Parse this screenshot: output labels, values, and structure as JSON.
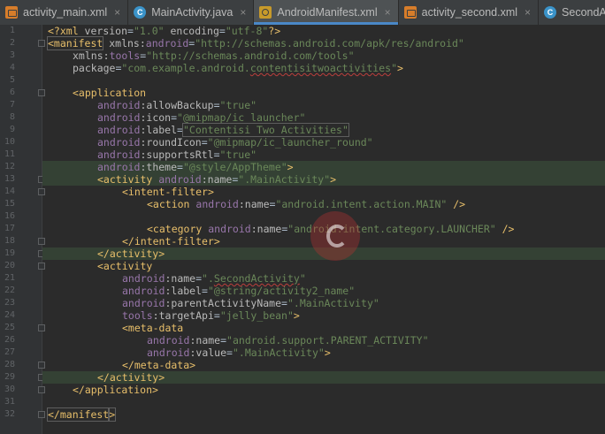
{
  "tabs": [
    {
      "label": "activity_main.xml",
      "icon": "xml-file-icon"
    },
    {
      "label": "MainActivity.java",
      "icon": "java-class-icon"
    },
    {
      "label": "AndroidManifest.xml",
      "icon": "manifest-file-icon",
      "active": true
    },
    {
      "label": "activity_second.xml",
      "icon": "xml-file-icon"
    },
    {
      "label": "SecondActi",
      "icon": "java-class-icon"
    }
  ],
  "close_glyph": "×",
  "line_numbers": [
    "1",
    "2",
    "3",
    "4",
    "5",
    "6",
    "7",
    "8",
    "9",
    "10",
    "11",
    "12",
    "13",
    "14",
    "15",
    "16",
    "17",
    "18",
    "19",
    "20",
    "21",
    "22",
    "23",
    "24",
    "25",
    "26",
    "27",
    "28",
    "29",
    "30",
    "31",
    "32"
  ],
  "code": {
    "l1": {
      "pi_open": "<?xml",
      "v_attr": " version",
      "v_eq": "=",
      "v_val": "\"1.0\"",
      "e_attr": " encoding",
      "e_eq": "=",
      "e_val": "\"utf-8\"",
      "pi_close": "?>"
    },
    "l2": {
      "tag": "<manifest",
      "ns_attr": " xmlns",
      "colon": ":",
      "ns": "android",
      "eq": "=",
      "val": "\"http://schemas.android.com/apk/res/android\""
    },
    "l3": {
      "ns_attr": "xmlns",
      "colon": ":",
      "ns": "tools",
      "eq": "=",
      "val": "\"http://schemas.android.com/tools\""
    },
    "l4": {
      "attr": "package",
      "eq": "=",
      "val_start": "\"com.example.android.",
      "val_squig": "contentisitwoactivities",
      "val_end": "\"",
      "close": ">"
    },
    "l7": {
      "tag": "<application"
    },
    "l8": {
      "ns": "android",
      "colon": ":",
      "attr": "allowBackup",
      "eq": "=",
      "val": "\"true\""
    },
    "l9": {
      "ns": "android",
      "colon": ":",
      "attr": "icon",
      "eq": "=",
      "val": "\"@mipmap/ic_launcher\""
    },
    "l10": {
      "ns": "android",
      "colon": ":",
      "attr": "label",
      "eq": "=",
      "val": "\"Contentisi Two Activities\""
    },
    "l11": {
      "ns": "android",
      "colon": ":",
      "attr": "roundIcon",
      "eq": "=",
      "val": "\"@mipmap/ic_launcher_round\""
    },
    "l12": {
      "ns": "android",
      "colon": ":",
      "attr": "supportsRtl",
      "eq": "=",
      "val": "\"true\""
    },
    "l13": {
      "ns": "android",
      "colon": ":",
      "attr": "theme",
      "eq": "=",
      "val": "\"@style/AppTheme\"",
      "close": ">"
    },
    "l14": {
      "tag": "<activity",
      "ns": " android",
      "colon": ":",
      "attr": "name",
      "eq": "=",
      "val": "\".MainActivity\"",
      "close": ">"
    },
    "l15": {
      "tag": "<intent-filter",
      "close": ">"
    },
    "l16": {
      "tag": "<action",
      "ns": " android",
      "colon": ":",
      "attr": "name",
      "eq": "=",
      "val": "\"android.intent.action.MAIN\"",
      "close": " />"
    },
    "l18": {
      "tag": "<category",
      "ns": " android",
      "colon": ":",
      "attr": "name",
      "eq": "=",
      "val": "\"android.intent.category.LAUNCHER\"",
      "close": " />"
    },
    "l19": {
      "tag": "</intent-filter",
      "close": ">"
    },
    "l20": {
      "tag": "</activity",
      "close": ">"
    },
    "l21": {
      "tag": "<activity"
    },
    "l22": {
      "ns": "android",
      "colon": ":",
      "attr": "name",
      "eq": "=",
      "val_start": "\".",
      "val_squig": "SecondActivity",
      "val_end": "\""
    },
    "l23": {
      "ns": "android",
      "colon": ":",
      "attr": "label",
      "eq": "=",
      "val": "\"@string/activity2_name\""
    },
    "l24": {
      "ns": "android",
      "colon": ":",
      "attr": "parentActivityName",
      "eq": "=",
      "val": "\".MainActivity\""
    },
    "l25": {
      "ns": "tools",
      "colon": ":",
      "attr": "targetApi",
      "eq": "=",
      "val": "\"jelly_bean\"",
      "close": ">"
    },
    "l26": {
      "tag": "<meta-data"
    },
    "l27": {
      "ns": "android",
      "colon": ":",
      "attr": "name",
      "eq": "=",
      "val": "\"android.support.PARENT_ACTIVITY\""
    },
    "l28": {
      "ns": "android",
      "colon": ":",
      "attr": "value",
      "eq": "=",
      "val": "\".MainActivity\"",
      "close": ">"
    },
    "l29": {
      "tag": "</meta-data",
      "close": ">"
    },
    "l30": {
      "tag": "</activity",
      "close": ">"
    },
    "l31": {
      "tag": "</application",
      "close": ">"
    },
    "l33": {
      "tag": "</manifest",
      "close": ">"
    }
  },
  "colors": {
    "background": "#2b2b2b",
    "tab_active_underline": "#4a88c7",
    "tag": "#e8bf6a",
    "namespace": "#9876aa",
    "string_value": "#6a8759",
    "highlight_line": "#344134"
  }
}
